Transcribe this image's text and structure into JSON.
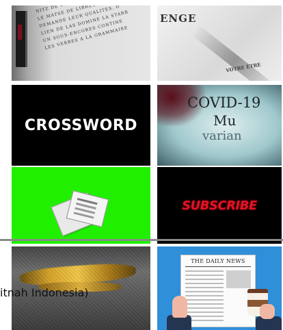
{
  "tiles": [
    {
      "id": "manuscript",
      "lines": [
        "NITZ DE VOMMENTARI IN SI UN",
        "LE MATSE DE LIBRES LANGUES",
        "DEMANDE LEUR QUALITES, D",
        "LIEN DE LAS DOMINE LA STARB",
        "UN SOUS-ENCORES CONTINE",
        "LES VERBES A LA GRAMMAIRE"
      ]
    },
    {
      "id": "challenge",
      "word": "ENGE",
      "small": "VOTRE ÉTRE"
    },
    {
      "id": "crossword",
      "label": "CROSSWORD"
    },
    {
      "id": "covid",
      "line1": "COVID-19",
      "line2": "Mu",
      "line3": "varian"
    },
    {
      "id": "green-screen-newspaper"
    },
    {
      "id": "subscribe",
      "label": "SUBSCRIBE"
    },
    {
      "id": "gold-debris"
    },
    {
      "id": "daily-news",
      "title": "THE DAILY NEWS"
    }
  ],
  "overlay": {
    "text": "itnah Indonesia)"
  },
  "colors": {
    "green_screen": "#20f000",
    "subscribe_red": "#e01428",
    "news_blue": "#2f8fd8"
  }
}
